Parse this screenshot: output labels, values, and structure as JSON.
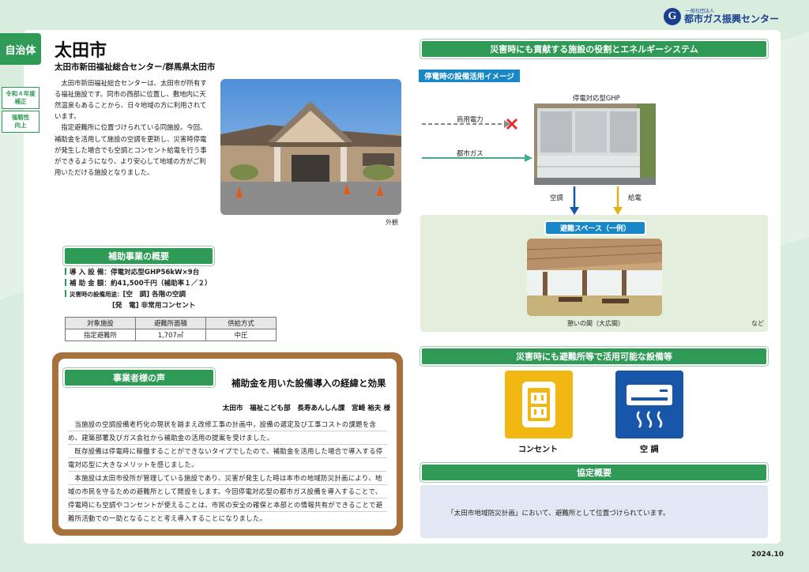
{
  "header": {
    "logo_small": "一般社団法人",
    "logo_main": "都市ガス振興センター",
    "logo_mark": "G",
    "category_tag": "自治体",
    "badges": [
      "令和４年度\n補正",
      "強靱性\n向上"
    ]
  },
  "profile": {
    "city": "太田市",
    "facility_line": "太田市新田福祉総合センター/群馬県太田市",
    "intro_paragraphs": [
      "太田市新田福祉総合センターは、太田市が所有する福祉施設です。同市の西部に位置し、敷地内に天然温泉もあることから、日々地域の方に利用されています。",
      "指定避難所に位置づけられている同施設。今回、補助金を活用して施設の空調を更新し、災害時停電が発生した場合でも空調とコンセント給電を行う事ができるようになり、より安心して地域の方がご利用いただける施設となりました。"
    ],
    "exterior_caption": "外観"
  },
  "subsidy": {
    "heading": "補助事業の概要",
    "items": [
      "導 入 設 備：停電対応型GHP56kW×9台",
      "補 助 金 額：約41,500千円（補助率１／２）"
    ],
    "disaster_use_label": "災害時の設備用途：",
    "disaster_use_1": "[空　調] 各階の空調",
    "disaster_use_2": "[発　電] 非常用コンセント",
    "table": {
      "headers": [
        "対象施設",
        "避難所面積",
        "供給方式"
      ],
      "row": [
        "指定避難所",
        "1,707㎡",
        "中圧"
      ]
    }
  },
  "voice": {
    "heading": "事業者様の声",
    "title": "補助金を用いた設備導入の経緯と効果",
    "author": "太田市　福祉こども部　長寿あんしん課　宮崎 裕夫 様",
    "paragraphs": [
      "当施設の空調設備老朽化の現状を踏まえ改修工事の計画中，設備の選定及び工事コストの課題を含め、建築部署及びガス会社から補助金の活用の提案を受けました。",
      "既存設備は停電時に稼働することができないタイプでしたので、補助金を活用した場合で導入する停電対応型に大きなメリットを感じました。",
      "本施設は太田市役所が管理している施設であり、災害が発生した時は本市の地域防災計画により、地域の市民を守るための避難所として開設をします。今回停電対応型の都市ガス設備を導入することで、停電時にも空調やコンセントが使えることは、市民の安全の確保と本部との情報共有ができることで避難所活動での一助となることと考え導入することになりました。"
    ]
  },
  "energy_system": {
    "heading": "災害時にも貢献する施設の役割とエネルギーシステム",
    "subheading": "停電時の設備活用イメージ",
    "ghp_label": "停電対応型GHP",
    "commercial_power": "商用電力",
    "city_gas": "都市ガス",
    "aircon": "空調",
    "power_supply": "給電",
    "shelter_label": "避難スペース（一例）",
    "hall_caption": "憩いの間（大広間）",
    "etc": "など"
  },
  "equipment": {
    "heading": "災害時にも避難所等で活用可能な設備等",
    "items": [
      {
        "label": "コンセント",
        "icon": "outlet-icon",
        "color": "#f1b813"
      },
      {
        "label": "空 調",
        "icon": "air-conditioner-icon",
        "color": "#1756a8"
      }
    ]
  },
  "agreement": {
    "heading": "協定概要",
    "text": "「太田市地域防災計画」において、避難所として位置づけられています。"
  },
  "footer": {
    "date": "2024.10"
  },
  "colors": {
    "accent_green": "#2e9a55",
    "accent_blue": "#1787c8",
    "frame_brown": "#a7713c"
  }
}
